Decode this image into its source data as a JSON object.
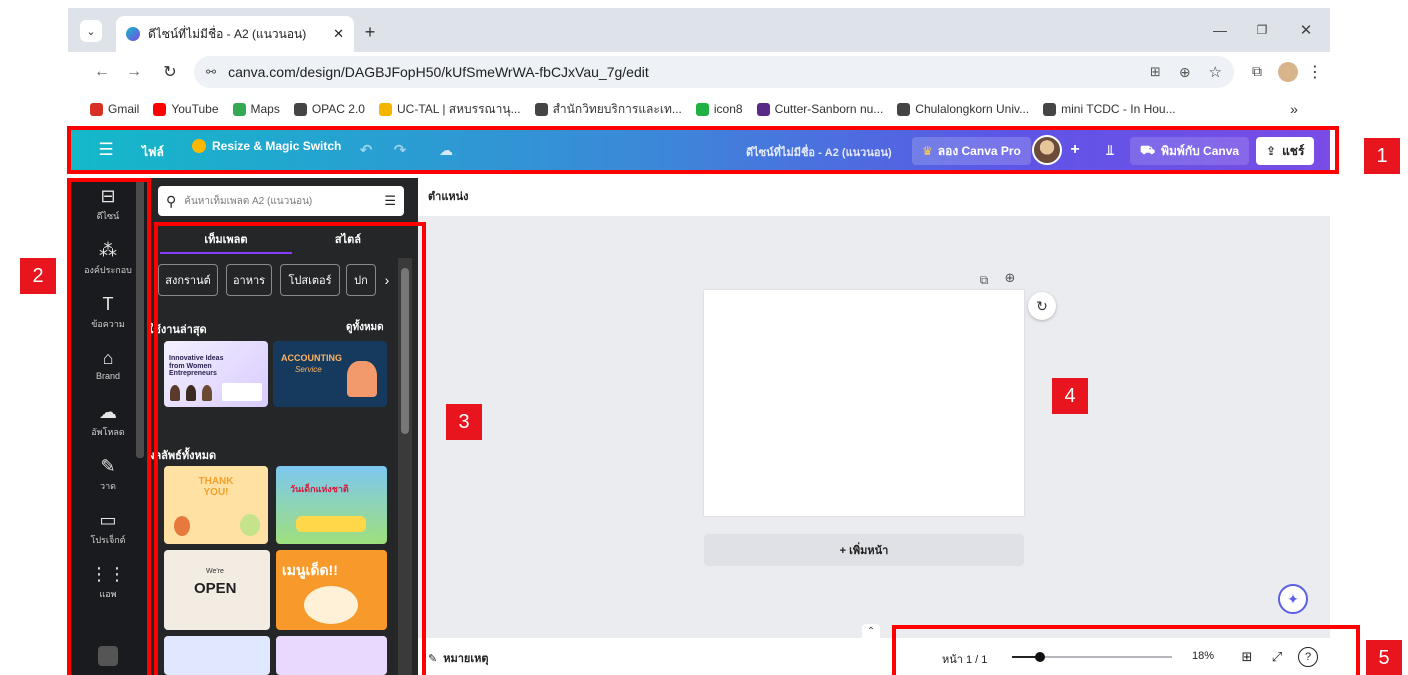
{
  "browser": {
    "tab_title": "ดีไซน์ที่ไม่มีชื่อ - A2 (แนวนอน)",
    "url": "canva.com/design/DAGBJFopH50/kUfSmeWrWA-fbCJxVau_7g/edit",
    "bookmarks": [
      {
        "label": "Gmail",
        "icon": "gmail-icon",
        "color": "#d93025"
      },
      {
        "label": "YouTube",
        "icon": "youtube-icon",
        "color": "#ff0000"
      },
      {
        "label": "Maps",
        "icon": "maps-icon",
        "color": "#34a853"
      },
      {
        "label": "OPAC 2.0",
        "icon": "globe-icon",
        "color": "#444444"
      },
      {
        "label": "UC-TAL | สหบรรณานุ...",
        "icon": "uctal-icon",
        "color": "#f4b400"
      },
      {
        "label": "สำนักวิทยบริการและเท...",
        "icon": "globe-icon",
        "color": "#444444"
      },
      {
        "label": "icon8",
        "icon": "icon8-icon",
        "color": "#1fb141"
      },
      {
        "label": "Cutter-Sanborn nu...",
        "icon": "cutter-icon",
        "color": "#5b2a86"
      },
      {
        "label": "Chulalongkorn Univ...",
        "icon": "globe-icon",
        "color": "#444444"
      },
      {
        "label": "mini TCDC - In Hou...",
        "icon": "globe-icon",
        "color": "#444444"
      }
    ]
  },
  "topbar": {
    "file": "ไฟล์",
    "resize": "Resize & Magic Switch",
    "doc_title": "ดีไซน์ที่ไม่มีชื่อ - A2 (แนวนอน)",
    "try_pro": "ลอง Canva Pro",
    "print": "พิมพ์กับ Canva",
    "share": "แชร์"
  },
  "rail": [
    {
      "label": "ดีไซน์",
      "icon": "design-icon"
    },
    {
      "label": "องค์ประกอบ",
      "icon": "elements-icon"
    },
    {
      "label": "ข้อความ",
      "icon": "text-icon"
    },
    {
      "label": "Brand",
      "icon": "brand-icon"
    },
    {
      "label": "อัพโหลด",
      "icon": "upload-icon"
    },
    {
      "label": "วาด",
      "icon": "draw-icon"
    },
    {
      "label": "โปรเจ็กต์",
      "icon": "folder-icon"
    },
    {
      "label": "แอพ",
      "icon": "apps-icon"
    }
  ],
  "panel": {
    "search_placeholder": "ค้นหาเท็มเพลต A2 (แนวนอน)",
    "tab_templates": "เท็มเพลต",
    "tab_styles": "สไตล์",
    "chips": [
      "สงกรานต์",
      "อาหาร",
      "โปสเตอร์",
      "ปก"
    ],
    "recent_heading": "ใช้งานล่าสุด",
    "see_all": "ดูทั้งหมด",
    "all_results": "ผลลัพธ์ทั้งหมด",
    "thumbs": {
      "t1_title": "Innovative Ideas from Women Entrepreneurs",
      "t2_title": "ACCOUNTING",
      "t2_sub": "Service",
      "t3_title": "THANK YOU!",
      "t4_title": "วันเด็กแห่งชาติ",
      "t5_title": "OPEN",
      "t5_pre": "We're",
      "t6_title": "เมนูเด็ด!!"
    }
  },
  "canvas": {
    "position_label": "ตำแหน่ง",
    "add_page": "+ เพิ่มหน้า"
  },
  "bottom": {
    "notes": "หมายเหตุ",
    "page": "หน้า 1 / 1",
    "zoom": "18%",
    "zoom_level": 0.18
  },
  "annotations": [
    "1",
    "2",
    "3",
    "4",
    "5"
  ],
  "colors": {
    "annotation_red": "#e8141e",
    "pro_purple": "#7d2ae8",
    "share_bg": "#ffffff"
  }
}
